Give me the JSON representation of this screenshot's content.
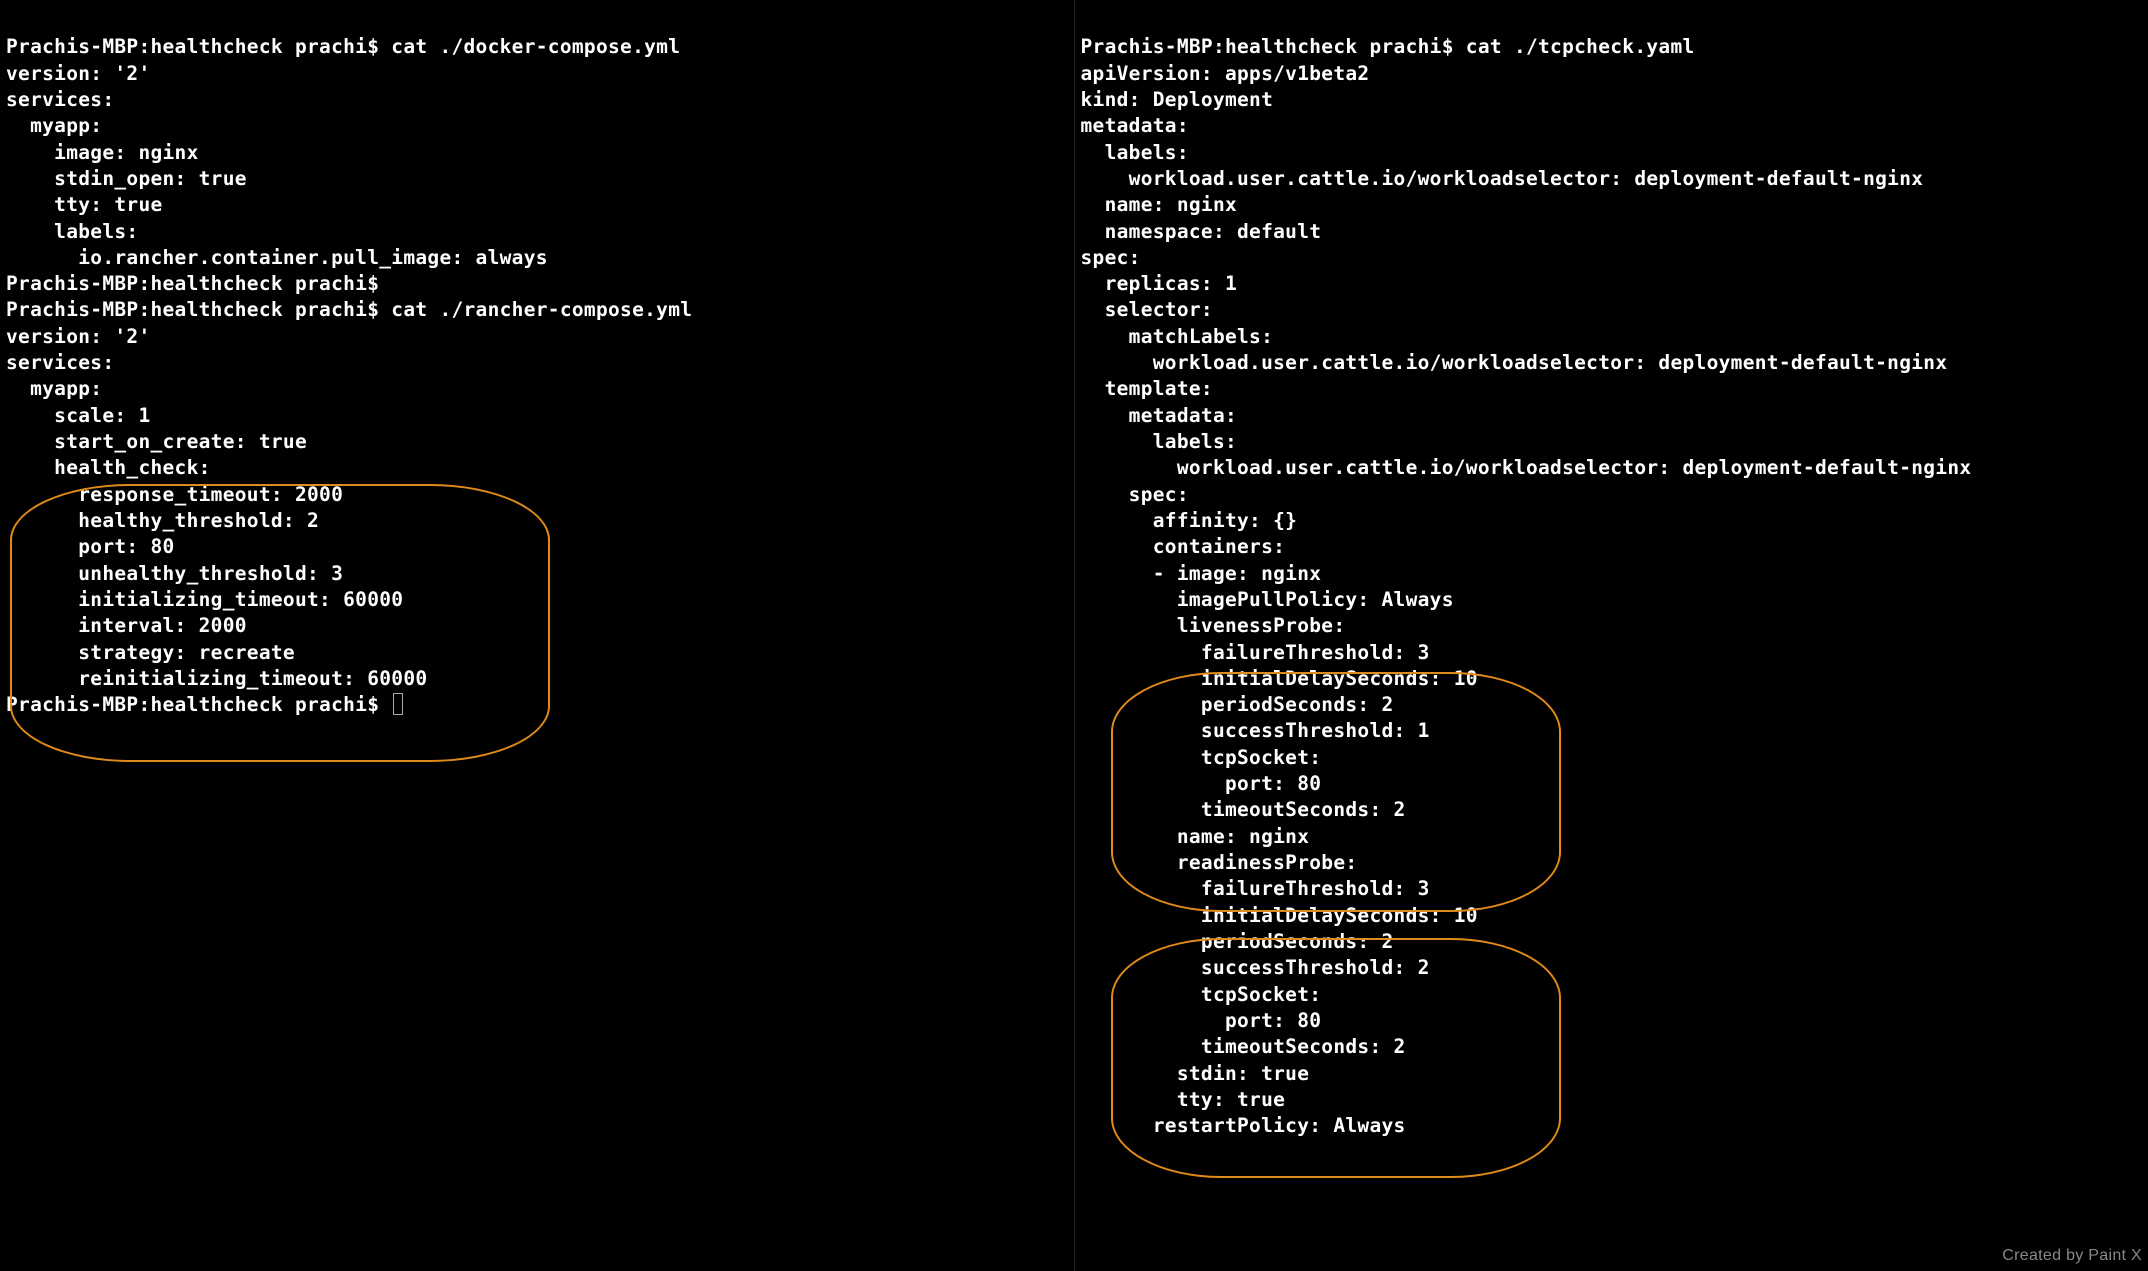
{
  "left": {
    "prompt1_host": "Prachis-MBP:healthcheck prachi$ ",
    "prompt1_cmd": "cat ./docker-compose.yml",
    "docker_compose": "version: '2'\nservices:\n  myapp:\n    image: nginx\n    stdin_open: true\n    tty: true\n    labels:\n      io.rancher.container.pull_image: always",
    "prompt2_host": "Prachis-MBP:healthcheck prachi$",
    "prompt3_host": "Prachis-MBP:healthcheck prachi$ ",
    "prompt3_cmd": "cat ./rancher-compose.yml",
    "rancher_compose": "version: '2'\nservices:\n  myapp:\n    scale: 1\n    start_on_create: true\n    health_check:\n      response_timeout: 2000\n      healthy_threshold: 2\n      port: 80\n      unhealthy_threshold: 3\n      initializing_timeout: 60000\n      interval: 2000\n      strategy: recreate\n      reinitializing_timeout: 60000",
    "prompt4_host": "Prachis-MBP:healthcheck prachi$ "
  },
  "right": {
    "prompt1_host": "Prachis-MBP:healthcheck prachi$ ",
    "prompt1_cmd": "cat ./tcpcheck.yaml",
    "tcpcheck": "apiVersion: apps/v1beta2\nkind: Deployment\nmetadata:\n  labels:\n    workload.user.cattle.io/workloadselector: deployment-default-nginx\n  name: nginx\n  namespace: default\nspec:\n  replicas: 1\n  selector:\n    matchLabels:\n      workload.user.cattle.io/workloadselector: deployment-default-nginx\n  template:\n    metadata:\n      labels:\n        workload.user.cattle.io/workloadselector: deployment-default-nginx\n    spec:\n      affinity: {}\n      containers:\n      - image: nginx\n        imagePullPolicy: Always\n        livenessProbe:\n          failureThreshold: 3\n          initialDelaySeconds: 10\n          periodSeconds: 2\n          successThreshold: 1\n          tcpSocket:\n            port: 80\n          timeoutSeconds: 2\n        name: nginx\n        readinessProbe:\n          failureThreshold: 3\n          initialDelaySeconds: 10\n          periodSeconds: 2\n          successThreshold: 2\n          tcpSocket:\n            port: 80\n          timeoutSeconds: 2\n        stdin: true\n        tty: true\n      restartPolicy: Always"
  },
  "watermark": "Created by Paint X"
}
